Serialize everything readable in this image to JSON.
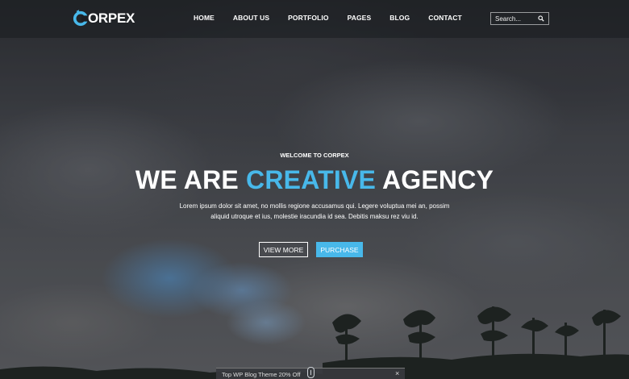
{
  "brand": {
    "logo_text": "ORPEX",
    "accent_color": "#48b8ea"
  },
  "nav": {
    "items": [
      "HOME",
      "ABOUT US",
      "PORTFOLIO",
      "PAGES",
      "BLOG",
      "CONTACT"
    ]
  },
  "search": {
    "placeholder": "Search...",
    "icon": "search-icon"
  },
  "hero": {
    "eyebrow": "WELCOME TO CORPEX",
    "headline_pre": "WE ARE ",
    "headline_accent": "CREATIVE",
    "headline_post": " AGENCY",
    "lead": "Lorem ipsum dolor sit amet, no mollis regione accusamus qui. Legere voluptua mei an, possim aliquid utroque et ius, molestie iracundia id sea. Debitis maksu rez viu id.",
    "primary_button": "VIEW MORE",
    "secondary_button": "PURCHASE"
  },
  "promo": {
    "text": "Top WP Blog Theme 20% Off",
    "close": "×"
  }
}
